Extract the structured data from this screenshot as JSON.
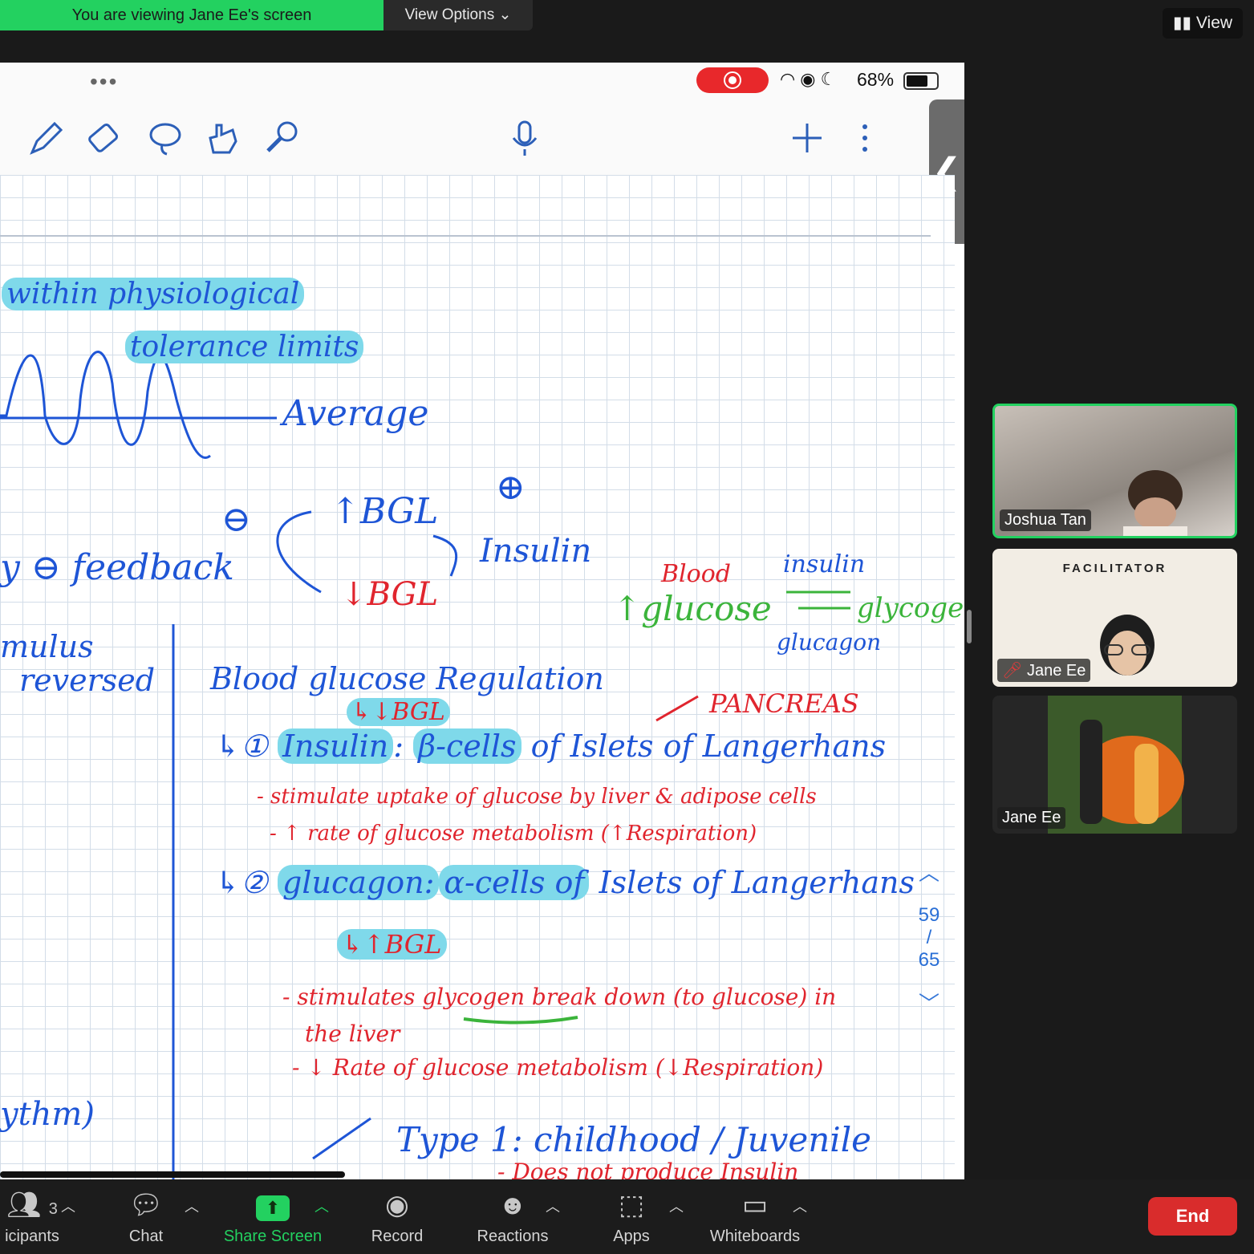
{
  "banner": {
    "text": "You are viewing Jane Ee's screen",
    "view_options": "View Options"
  },
  "top_right": {
    "view": "View"
  },
  "ipad": {
    "battery": "68%",
    "page_current": "59",
    "page_total": "65"
  },
  "notes": {
    "line1": "within physiological",
    "line2": "tolerance limits",
    "average": "Average",
    "neg": "⊖",
    "bgl_up": "↑BGL",
    "bgl_down": "↓BGL",
    "insulin_lbl": "Insulin",
    "plus": "⊕",
    "feedback": "y ⊖ feedback",
    "stimulus": "mulus",
    "reversed": "reversed",
    "blood": "Blood",
    "glucose": "↑glucose",
    "insulin_arrow": "insulin",
    "glycogen": "glycogen",
    "glucagon_arrow": "glucagon",
    "title": "Blood glucose Regulation",
    "pancreas": "PANCREAS",
    "sub_bgl": "↳↓BGL",
    "item1_a": "↳① ",
    "item1_insulin": "Insulin",
    "item1_colon": ": ",
    "item1_beta": "β-cells",
    "item1_rest": " of Islets of Langerhans",
    "item1_l1": "- stimulate uptake of glucose by liver & adipose cells",
    "item1_l2": "- ↑ rate of glucose metabolism (↑Respiration)",
    "item2_a": "↳② ",
    "item2_glucagon": "glucagon:",
    "item2_alpha": "α-cells of",
    "item2_rest": " Islets of Langerhans",
    "item2_sub": "↳↑BGL",
    "item2_l1": "- stimulates glycogen break down (to glucose) in",
    "item2_l1b": "the liver",
    "item2_l2": "- ↓ Rate of glucose metabolism (↓Respiration)",
    "rhythm": "ythm)",
    "type1": "Type 1: childhood / Juvenile",
    "type1_sub": "- Does not produce Insulin"
  },
  "participants": [
    {
      "name": "Joshua Tan"
    },
    {
      "name": "Jane Ee",
      "background_text": "FACILITATOR"
    },
    {
      "name": "Jane Ee"
    }
  ],
  "bottom_bar": {
    "participants_count": "3",
    "participants_label": "icipants",
    "chat": "Chat",
    "share_screen": "Share Screen",
    "record": "Record",
    "reactions": "Reactions",
    "apps": "Apps",
    "whiteboards": "Whiteboards",
    "end": "End"
  },
  "colors": {
    "accent_green": "#23d160",
    "end_red": "#d92c2c",
    "ink_blue": "#1e55d6",
    "ink_red": "#e0252e",
    "highlight": "#7fd9ea"
  }
}
